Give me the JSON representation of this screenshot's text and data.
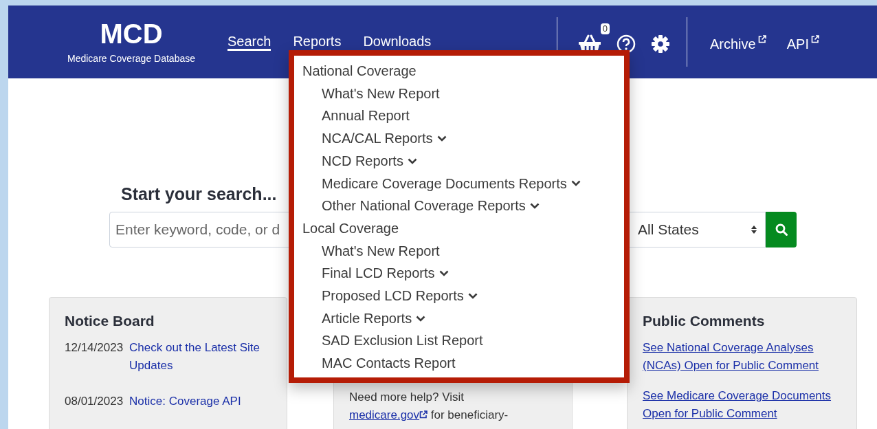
{
  "header": {
    "logo": {
      "title": "MCD",
      "subtitle": "Medicare Coverage Database"
    },
    "nav": [
      {
        "label": "Search",
        "selected": true
      },
      {
        "label": "Reports",
        "selected": false
      },
      {
        "label": "Downloads",
        "selected": false
      }
    ],
    "cart_count": "0",
    "external_links": [
      {
        "label": "Archive"
      },
      {
        "label": "API"
      }
    ]
  },
  "search": {
    "heading": "Start your search...",
    "keyword_field": {
      "placeholder": "Enter keyword, code, or d"
    },
    "state_select": {
      "value": "All States"
    }
  },
  "notice_board": {
    "title": "Notice Board",
    "notices": [
      {
        "date": "12/14/2023",
        "text": "Check out the Latest Site Updates"
      },
      {
        "date": "08/01/2023",
        "text": "Notice:  Coverage API"
      }
    ]
  },
  "help_card": {
    "text_before": "Need more help? Visit",
    "link": "medicare.gov",
    "text_after": "for beneficiary-"
  },
  "public_comments": {
    "title": "Public Comments",
    "links": [
      "See National Coverage Analyses (NCAs) Open for Public Comment",
      "See Medicare Coverage Documents Open for Public Comment"
    ]
  },
  "reports_menu": {
    "sections": [
      {
        "label": "National Coverage",
        "items": [
          {
            "label": "What's New Report",
            "expandable": false
          },
          {
            "label": "Annual Report",
            "expandable": false
          },
          {
            "label": "NCA/CAL Reports",
            "expandable": true
          },
          {
            "label": "NCD Reports",
            "expandable": true
          },
          {
            "label": "Medicare Coverage Documents Reports",
            "expandable": true
          },
          {
            "label": "Other National Coverage Reports",
            "expandable": true
          }
        ]
      },
      {
        "label": "Local Coverage",
        "items": [
          {
            "label": "What's New Report",
            "expandable": false
          },
          {
            "label": "Final LCD Reports",
            "expandable": true
          },
          {
            "label": "Proposed LCD Reports",
            "expandable": true
          },
          {
            "label": "Article Reports",
            "expandable": true
          },
          {
            "label": "SAD Exclusion List Report",
            "expandable": false
          },
          {
            "label": "MAC Contacts Report",
            "expandable": false
          }
        ]
      }
    ]
  }
}
